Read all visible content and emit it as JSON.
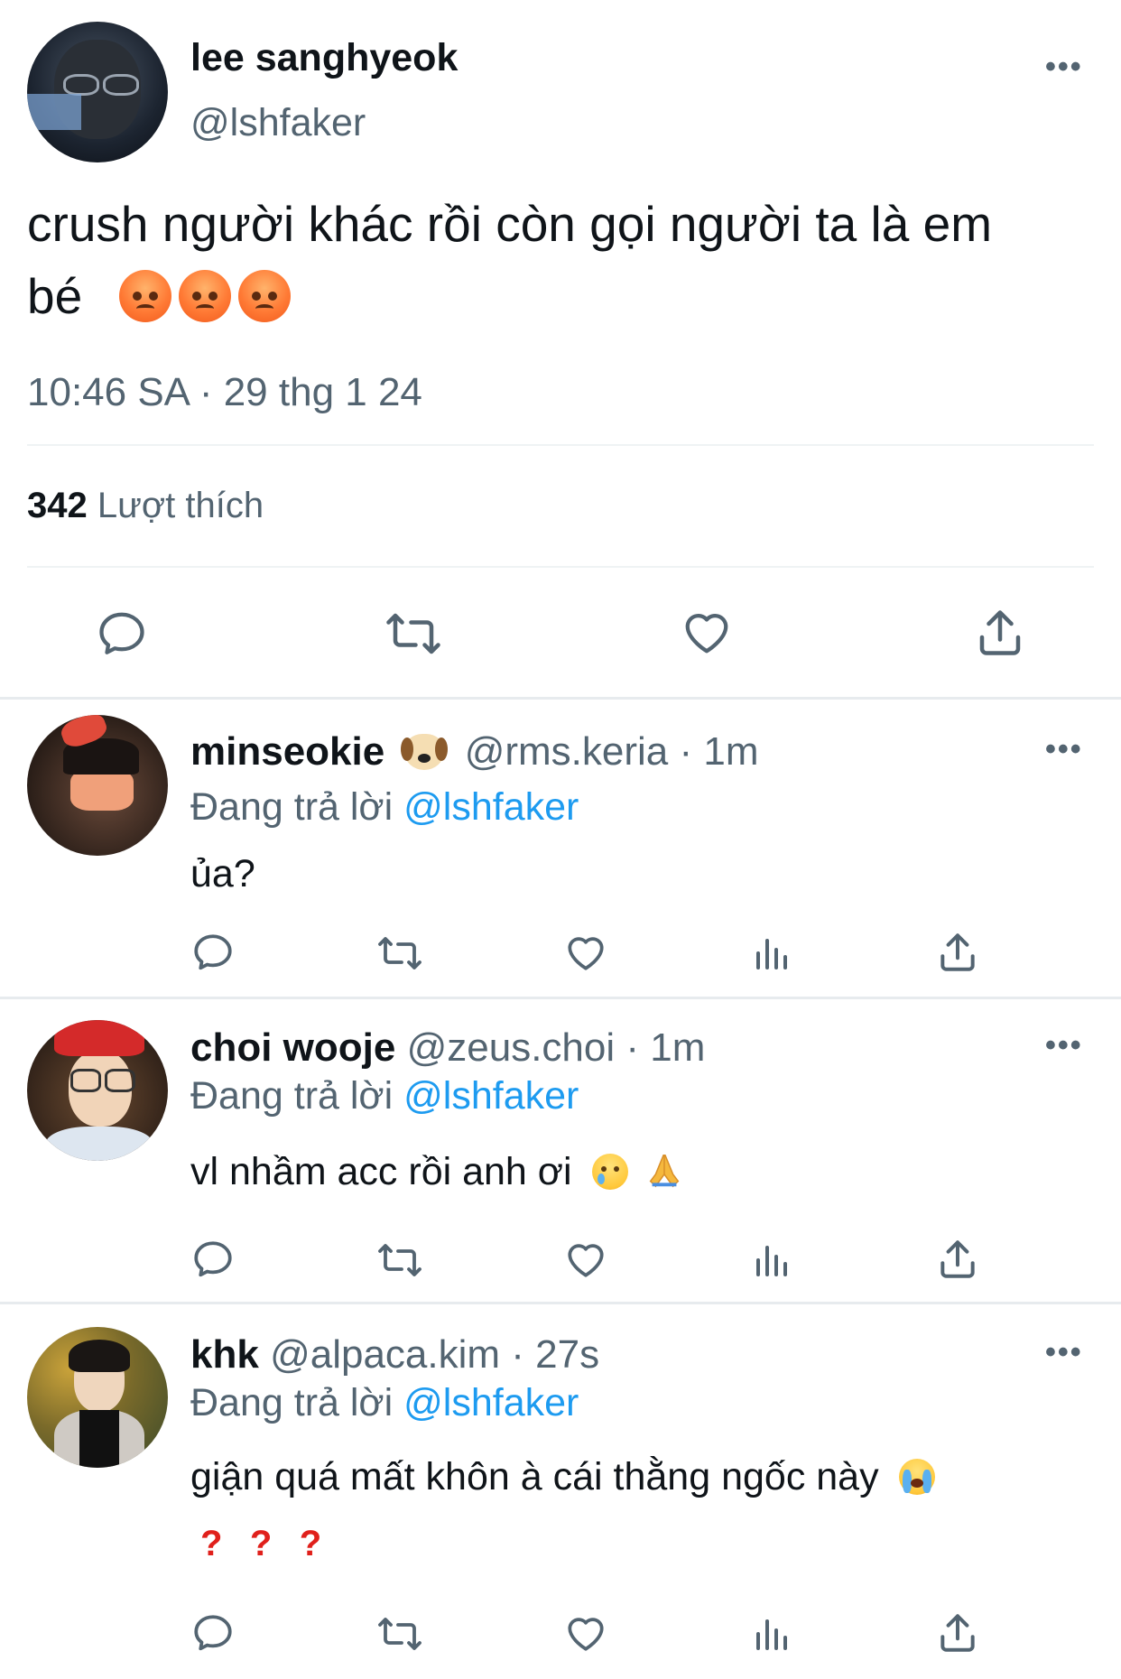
{
  "main_tweet": {
    "display_name": "lee sanghyeok",
    "handle": "@lshfaker",
    "text_line1": "crush người khác rồi còn gọi người ta là em",
    "text_line2": "bé",
    "emojis": [
      "angry-face",
      "angry-face",
      "angry-face"
    ],
    "timestamp": "10:46 SA · 29 thg 1 24",
    "likes_count": "342",
    "likes_label": "Lượt thích",
    "more_label": "•••"
  },
  "replies": [
    {
      "display_name": "minseokie",
      "name_emoji": "dog-face",
      "handle": "@rms.keria",
      "time": "· 1m",
      "replying_prefix": "Đang trả lời",
      "replying_to": "@lshfaker",
      "text": "ủa?",
      "more_label": "•••"
    },
    {
      "display_name": "choi wooje",
      "handle": "@zeus.choi",
      "time": "· 1m",
      "replying_prefix": "Đang trả lời",
      "replying_to": "@lshfaker",
      "text": "vl nhầm acc rồi anh ơi",
      "text_emojis": [
        "crying-face",
        "folded-hands"
      ],
      "more_label": "•••"
    },
    {
      "display_name": "khk",
      "handle": "@alpaca.kim",
      "time": "· 27s",
      "replying_prefix": "Đang trả lời",
      "replying_to": "@lshfaker",
      "text": "giận quá mất khôn à cái thằng ngốc này",
      "text_emojis": [
        "loudly-crying-face"
      ],
      "text_line2": [
        "?",
        "?",
        "?"
      ],
      "more_label": "•••"
    }
  ],
  "colors": {
    "link": "#1d9bf0",
    "secondary_text": "#536471",
    "primary_text": "#0f1419",
    "divider": "#eff3f4"
  }
}
